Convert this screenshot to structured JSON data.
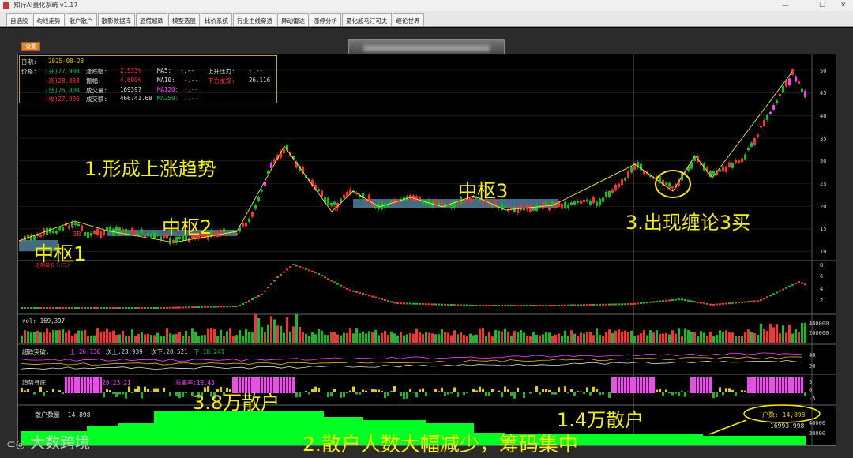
{
  "window": {
    "title": "知行AI量化系统 v1.17",
    "controls": [
      "—",
      "☐",
      "✕"
    ]
  },
  "tabs": [
    "自选股",
    "均线走势",
    "散户散户",
    "散影数据库",
    "恐慌超跌",
    "模型选股",
    "比价系统",
    "行业主线穿透",
    "异动雷达",
    "涨停分析",
    "量化超马汀可夫",
    "缠论世界"
  ],
  "toolbar": {
    "settings_label": "设置"
  },
  "infobox": {
    "date_label": "日期:",
    "date": "2025-08-28",
    "price_label": "价格:",
    "open": "(开)27.900",
    "high": "(高)28.880",
    "low": "(低)26.800",
    "close": "(收)27.930",
    "change_pct_label": "涨跌幅:",
    "change_pct": "2.533%",
    "amplitude_label": "振幅:",
    "amplitude": "4.690%",
    "volume_label": "成交量:",
    "volume": "169397",
    "turnover_label": "成交额:",
    "turnover": "466741.68",
    "ma5_label": "MA5:",
    "ma5": "-.--",
    "ma10_label": "MA10:",
    "ma10": "-.--",
    "ma120_label": "MA120:",
    "ma120": "-.--",
    "ma250_label": "MA250:",
    "ma250": "-.--",
    "resistance_label": "上升压力:",
    "resistance": "-.--",
    "support_label": "下方支撑:",
    "support": "26.116"
  },
  "price_axis": [
    "50",
    "45",
    "40",
    "35",
    "30",
    "25",
    "20",
    "15",
    "10"
  ],
  "macd_axis": [
    "8",
    "6",
    "4",
    "2"
  ],
  "vol_panel": {
    "label": "vol: 169,397",
    "axis": [
      "400000",
      "200000"
    ]
  },
  "break_panel": {
    "title": "超跌突破:",
    "up": "上:26.136",
    "mid": "次上:23.939",
    "low": "次下:20.521",
    "down": "下:18.241",
    "axis": [
      "40",
      "20"
    ]
  },
  "flow_panel": {
    "title": "趋势寻底",
    "text1": "离率120:23.21",
    "text2": "乖离率:19.43",
    "axis": [
      "5",
      "0",
      "-5"
    ]
  },
  "retail_panel": {
    "title": "散户数量: 14,898",
    "count_label": "户数: 14,898",
    "value": "16993.998",
    "axis": [
      "40000",
      "20000"
    ]
  },
  "annotations": {
    "uptrend": "1.形成上涨趋势",
    "pivot1": "中枢1",
    "pivot2": "中枢2",
    "pivot3": "中枢3",
    "buy3": "3.出现缠论3买",
    "retail_38k": "3.8万散户",
    "retail_14k": "1.4万散户",
    "retail_drop": "2.散户人数大幅减少，筹码集中",
    "mark_3b_a": "3B",
    "mark_3b_b": "3B",
    "mark_3b_c": "3B",
    "low_label": "近期最低 ?.?元?"
  },
  "watermark": {
    "text": "大数跨境"
  },
  "colors": {
    "up": "#ff3030",
    "down": "#10c020",
    "accent": "#f4f000",
    "magenta": "#ff40ff",
    "pivot_box": "#5a8fb0",
    "retail_bar": "#00ff22"
  }
}
